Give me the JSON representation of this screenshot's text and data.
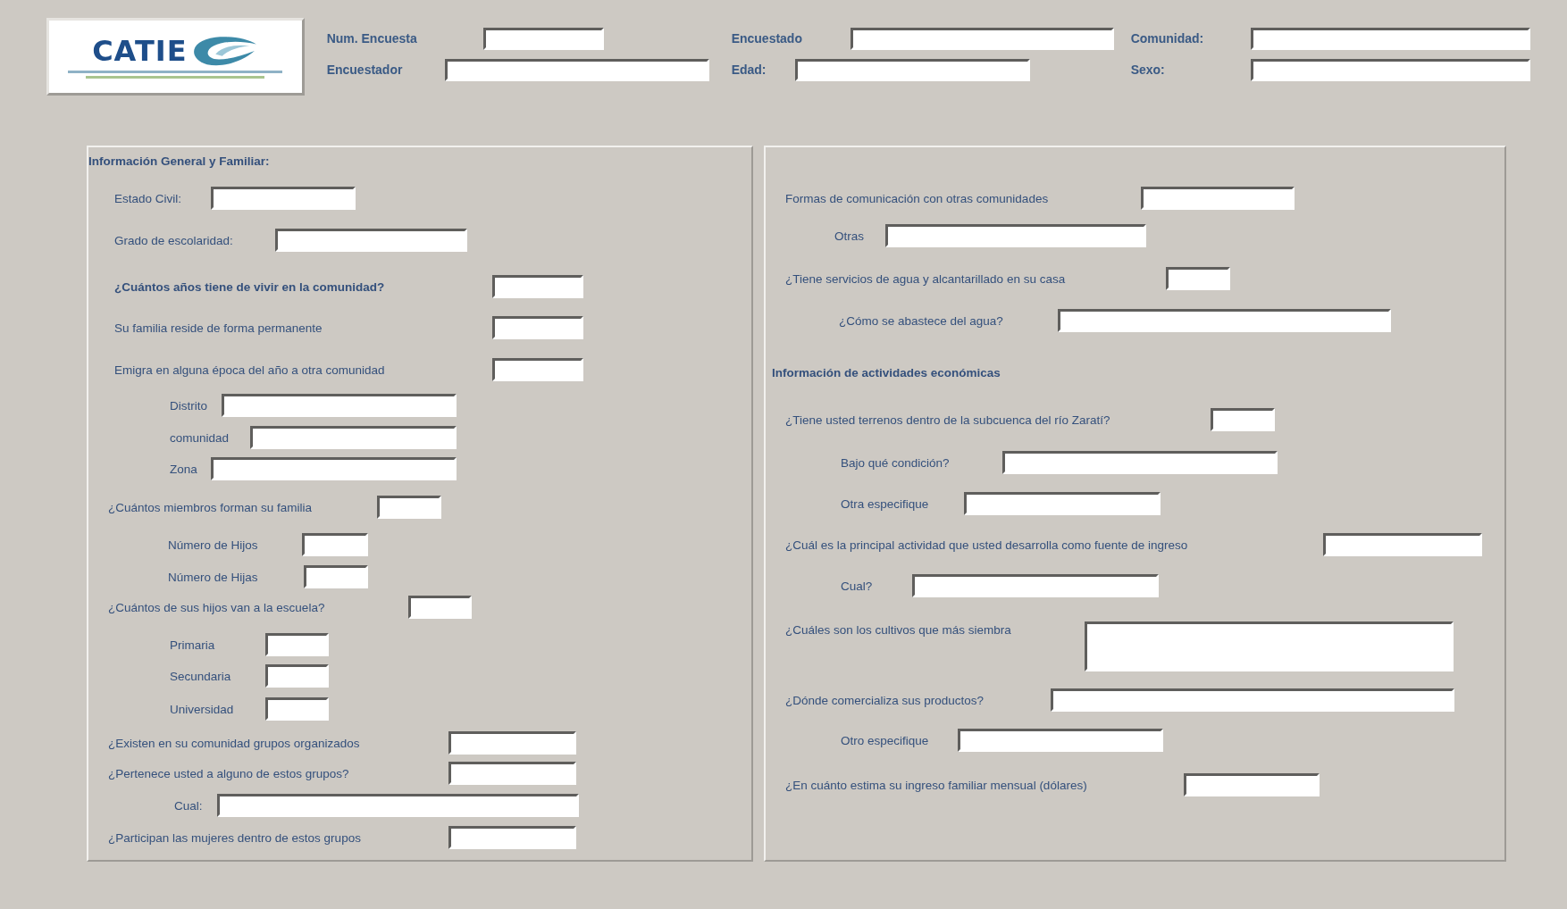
{
  "header": {
    "logo": {
      "text": "CATIE"
    },
    "fields": [
      {
        "label": "Num. Encuesta"
      },
      {
        "label": "Encuestado"
      },
      {
        "label": "Comunidad:"
      },
      {
        "label": "Encuestador"
      },
      {
        "label": "Edad:"
      },
      {
        "label": "Sexo:"
      }
    ]
  },
  "panels": [
    {
      "rows": [
        {
          "kind": "heading",
          "label": "Información General y Familiar:"
        },
        {
          "kind": "field",
          "label": "Estado Civil:"
        },
        {
          "kind": "field",
          "label": "Grado de escolaridad:"
        },
        {
          "kind": "strong-field",
          "label": "¿Cuántos años tiene de vivir en la comunidad?"
        },
        {
          "kind": "field",
          "label": "Su familia reside de forma permanente"
        },
        {
          "kind": "field",
          "label": "Emigra en alguna época del año a otra comunidad"
        },
        {
          "kind": "field",
          "label": "Distrito"
        },
        {
          "kind": "field",
          "label": "comunidad"
        },
        {
          "kind": "field",
          "label": "Zona"
        },
        {
          "kind": "field",
          "label": "¿Cuántos miembros forman su familia"
        },
        {
          "kind": "field",
          "label": "Número de Hijos"
        },
        {
          "kind": "field",
          "label": "Número de Hijas"
        },
        {
          "kind": "field",
          "label": "¿Cuántos de sus hijos van a la escuela?"
        },
        {
          "kind": "field",
          "label": "Primaria"
        },
        {
          "kind": "field",
          "label": "Secundaria"
        },
        {
          "kind": "field",
          "label": "Universidad"
        },
        {
          "kind": "field",
          "label": "¿Existen en su comunidad grupos organizados"
        },
        {
          "kind": "field",
          "label": "¿Pertenece usted a alguno de estos grupos?"
        },
        {
          "kind": "field",
          "label": "Cual:"
        },
        {
          "kind": "field",
          "label": "¿Participan las mujeres dentro de estos grupos"
        }
      ]
    },
    {
      "rows": [
        {
          "kind": "field",
          "label": "Formas de comunicación  con  otras comunidades"
        },
        {
          "kind": "field",
          "label": "Otras"
        },
        {
          "kind": "field",
          "label": "¿Tiene servicios de agua y alcantarillado en su casa"
        },
        {
          "kind": "field",
          "label": "¿Cómo se abastece del agua?"
        },
        {
          "kind": "heading",
          "label": "Información de actividades económicas"
        },
        {
          "kind": "field",
          "label": "¿Tiene usted terrenos dentro de la subcuenca del río Zaratí?"
        },
        {
          "kind": "field",
          "label": "Bajo qué condición?"
        },
        {
          "kind": "field",
          "label": "Otra especifique"
        },
        {
          "kind": "field",
          "label": "¿Cuál es la principal actividad que usted desarrolla como fuente de ingreso"
        },
        {
          "kind": "field",
          "label": "Cual?"
        },
        {
          "kind": "area",
          "label": "¿Cuáles son los cultivos que más siembra"
        },
        {
          "kind": "field",
          "label": "¿Dónde comercializa sus productos?"
        },
        {
          "kind": "field",
          "label": "Otro especifique"
        },
        {
          "kind": "field",
          "label": "¿En cuánto estima su ingreso familiar mensual (dólares)"
        }
      ]
    }
  ]
}
